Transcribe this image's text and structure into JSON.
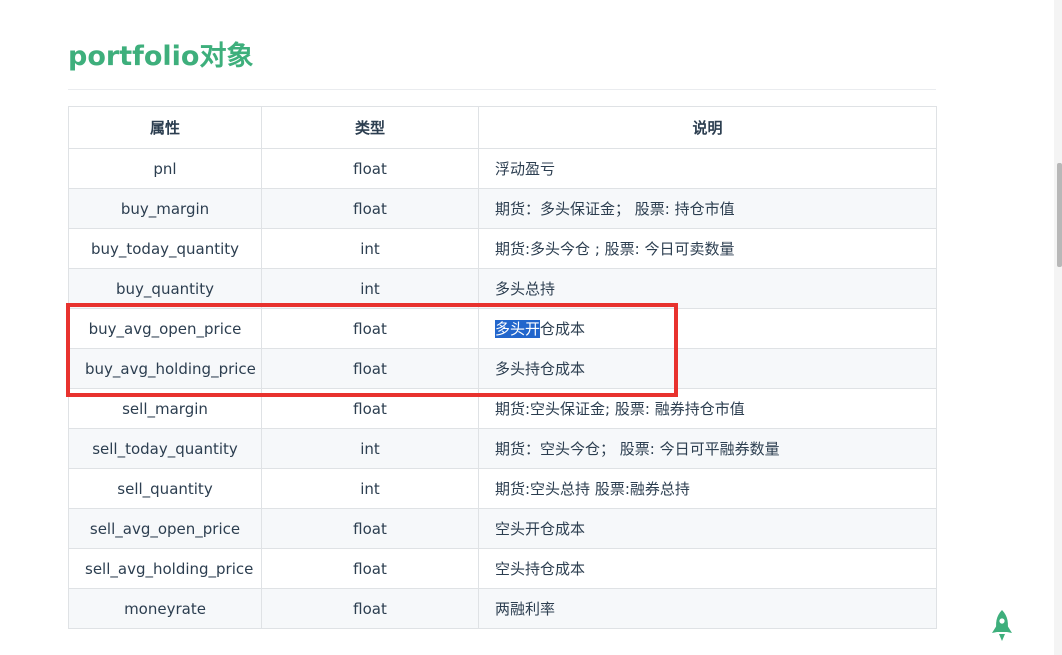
{
  "section": {
    "heading": "portfolio对象"
  },
  "table": {
    "headers": [
      "属性",
      "类型",
      "说明"
    ],
    "rows": [
      [
        "pnl",
        "float",
        "浮动盈亏"
      ],
      [
        "buy_margin",
        "float",
        "期货：多头保证金； 股票: 持仓市值"
      ],
      [
        "buy_today_quantity",
        "int",
        "期货:多头今仓 ; 股票: 今日可卖数量"
      ],
      [
        "buy_quantity",
        "int",
        "多头总持"
      ],
      [
        "buy_avg_open_price",
        "float",
        "多头开仓成本"
      ],
      [
        "buy_avg_holding_price",
        "float",
        "多头持仓成本"
      ],
      [
        "sell_margin",
        "float",
        "期货:空头保证金; 股票: 融券持仓市值"
      ],
      [
        "sell_today_quantity",
        "int",
        "期货：空头今仓； 股票: 今日可平融券数量"
      ],
      [
        "sell_quantity",
        "int",
        "期货:空头总持 股票:融券总持"
      ],
      [
        "sell_avg_open_price",
        "float",
        "空头开仓成本"
      ],
      [
        "sell_avg_holding_price",
        "float",
        "空头持仓成本"
      ],
      [
        "moneyrate",
        "float",
        "两融利率"
      ]
    ],
    "selection": {
      "row": 4,
      "selected_text": "多头开",
      "rest_text": "仓成本"
    }
  },
  "colors": {
    "accent": "#3eaf7c",
    "highlight_border": "#e8322e",
    "selection_bg": "#2266cc"
  },
  "icons": {
    "back_to_top": "rocket-icon"
  }
}
